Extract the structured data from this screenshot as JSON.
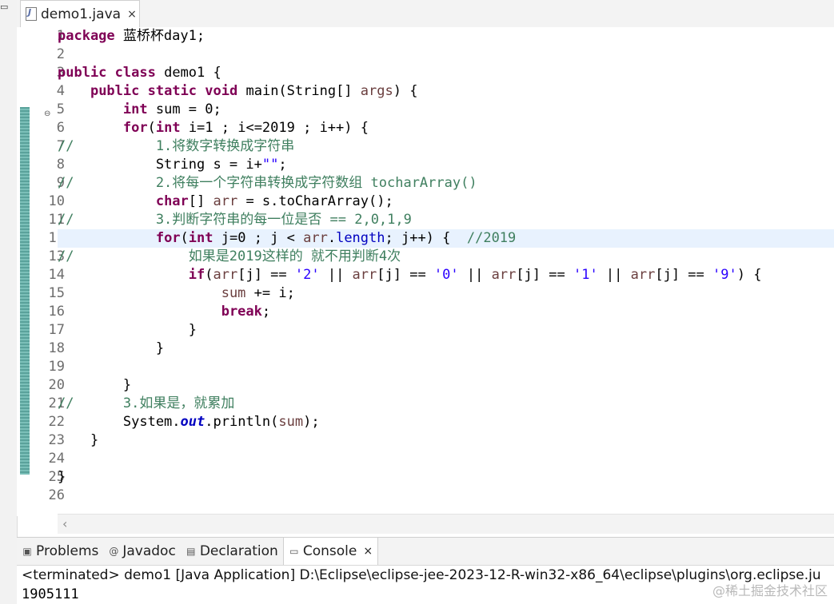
{
  "editor_tab": {
    "label": "demo1.java",
    "close": "×"
  },
  "line_numbers": [
    "1",
    "2",
    "3",
    "4",
    "5",
    "6",
    "7",
    "8",
    "9",
    "10",
    "11",
    "12",
    "13",
    "14",
    "15",
    "16",
    "17",
    "18",
    "19",
    "20",
    "21",
    "22",
    "23",
    "24",
    "25",
    "26"
  ],
  "code": {
    "l1_kw": "package",
    "l1_rest": " 蓝桥杯day1;",
    "l3_kw1": "public",
    "l3_kw2": "class",
    "l3_rest": " demo1 {",
    "l4_kw1": "public",
    "l4_kw2": "static",
    "l4_kw3": "void",
    "l4_a": " main(String[] ",
    "l4_var": "args",
    "l4_b": ") {",
    "l5_kw": "int",
    "l5_rest": " sum = 0;",
    "l6_kw1": "for",
    "l6_a": "(",
    "l6_kw2": "int",
    "l6_rest": " i=1 ; i<=2019 ; i++) {",
    "l7": "//          1.将数字转换成字符串",
    "l8_a": "            String s = i+",
    "l8_str": "\"\"",
    "l8_b": ";",
    "l9": "//          2.将每一个字符串转换成字符数组 tocharArray()",
    "l10_kw": "char",
    "l10_a": "[] ",
    "l10_var": "arr",
    "l10_b": " = s.toCharArray();",
    "l11": "//          3.判断字符串的每一位是否 == 2,0,1,9",
    "l12_kw1": "for",
    "l12_a": "(",
    "l12_kw2": "int",
    "l12_b": " j=0 ; j < ",
    "l12_var": "arr",
    "l12_c": ".",
    "l12_fld": "length",
    "l12_d": "; j++) {  ",
    "l12_cmt": "//2019",
    "l13": "//              如果是2019这样的 就不用判断4次",
    "l14_kw": "if",
    "l14_a": "(",
    "l14_v1": "arr",
    "l14_b": "[j] == ",
    "l14_s1": "'2'",
    "l14_c": " || ",
    "l14_v2": "arr",
    "l14_d": "[j] == ",
    "l14_s2": "'0'",
    "l14_e": " || ",
    "l14_v3": "arr",
    "l14_f": "[j] == ",
    "l14_s3": "'1'",
    "l14_g": " || ",
    "l14_v4": "arr",
    "l14_h": "[j] == ",
    "l14_s4": "'9'",
    "l14_i": ") {",
    "l15_var": "sum",
    "l15_rest": " += i;",
    "l16_kw": "break",
    "l16_rest": ";",
    "l17": "                }",
    "l18": "            }",
    "l20": "        }",
    "l21": "//      3.如果是，就累加",
    "l22_a": "        System.",
    "l22_sfld": "out",
    "l22_b": ".println(",
    "l22_var": "sum",
    "l22_c": ");",
    "l23": "    }",
    "l25": "}"
  },
  "panel": {
    "tabs": [
      {
        "label": "Problems",
        "icon": "problems-icon"
      },
      {
        "label": "Javadoc",
        "icon": "at-icon"
      },
      {
        "label": "Declaration",
        "icon": "declaration-icon"
      },
      {
        "label": "Console",
        "icon": "console-icon"
      }
    ],
    "close": "×",
    "status": "<terminated> demo1 [Java Application] D:\\Eclipse\\eclipse-jee-2023-12-R-win32-x86_64\\eclipse\\plugins\\org.eclipse.ju",
    "output": "1905111"
  },
  "watermark": "@稀土掘金技术社区"
}
